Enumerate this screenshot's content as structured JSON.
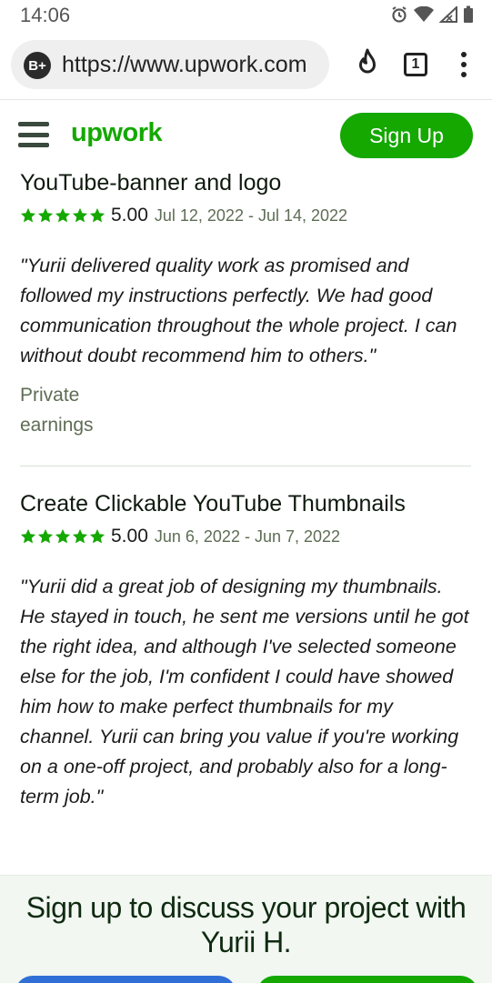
{
  "status_bar": {
    "time": "14:06"
  },
  "browser": {
    "badge": "B+",
    "url": "https://www.upwork.com",
    "tab_count": "1"
  },
  "header": {
    "logo": "upwork",
    "signup_label": "Sign Up"
  },
  "reviews": [
    {
      "title": "YouTube-banner and logo",
      "rating": "5.00",
      "dates": "Jul 12, 2022 - Jul 14, 2022",
      "quote": "\"Yurii delivered quality work as promised and followed my instructions perfectly. We had good communication throughout the whole project. I can without doubt recommend him to others.\"",
      "earnings": "Private earnings"
    },
    {
      "title": "Create Clickable YouTube Thumbnails",
      "rating": "5.00",
      "dates": "Jun 6, 2022 - Jun 7, 2022",
      "quote": "\"Yurii did a great job of designing my thumbnails. He stayed in touch, he sent me versions until he got the right idea, and although I've selected someone else for the job, I'm confident I could have showed him how to make perfect thumbnails for my channel. Yurii can bring you value if you're working on a one-off project, and probably also for a long-term job.\""
    }
  ],
  "cta": {
    "text": "Sign up to discuss your project with Yurii H."
  },
  "colors": {
    "brand": "#14a800",
    "star": "#14a800",
    "muted": "#5e6d55"
  }
}
